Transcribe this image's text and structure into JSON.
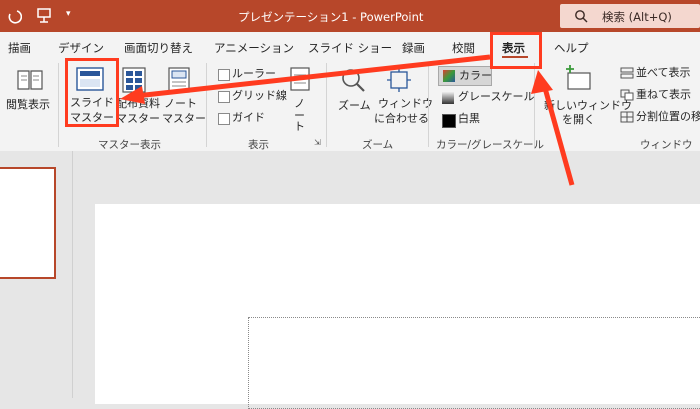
{
  "titlebar": {
    "title": "プレゼンテーション1 - PowerPoint",
    "search_label": "検索 (Alt+Q)"
  },
  "tabs": [
    {
      "label": "描画"
    },
    {
      "label": "デザイン"
    },
    {
      "label": "画面切り替え"
    },
    {
      "label": "アニメーション"
    },
    {
      "label": "スライド ショー"
    },
    {
      "label": "録画"
    },
    {
      "label": "校閲"
    },
    {
      "label": "表示"
    },
    {
      "label": "ヘルプ"
    }
  ],
  "ribbon": {
    "reading_view": "閲覧表示",
    "slide_master": {
      "line1": "スライド",
      "line2": "マスター"
    },
    "handout_master": {
      "line1": "配布資料",
      "line2": "マスター"
    },
    "notes_master": {
      "line1": "ノート",
      "line2": "マスター"
    },
    "group_master_views": "マスター表示",
    "ruler": "ルーラー",
    "gridlines": "グリッド線",
    "guides": "ガイド",
    "notes": {
      "line1": "ノ",
      "line2": "ー",
      "line3": "ト"
    },
    "group_show": "表示",
    "zoom": "ズーム",
    "fit_to_window": {
      "line1": "ウィンドウ",
      "line2": "に合わせる"
    },
    "group_zoom": "ズーム",
    "color": "カラー",
    "grayscale": "グレースケール",
    "black_white": "白黒",
    "group_color": "カラー/グレースケール",
    "new_window": {
      "line1": "新しいウィンドウ",
      "line2": "を開く"
    },
    "arrange_all": "並べて表示",
    "cascade": "重ねて表示",
    "move_split": "分割位置の移",
    "group_window": "ウィンドウ"
  },
  "colors": {
    "accent": "#b7472a",
    "annotation_red": "#ff3b1f"
  }
}
